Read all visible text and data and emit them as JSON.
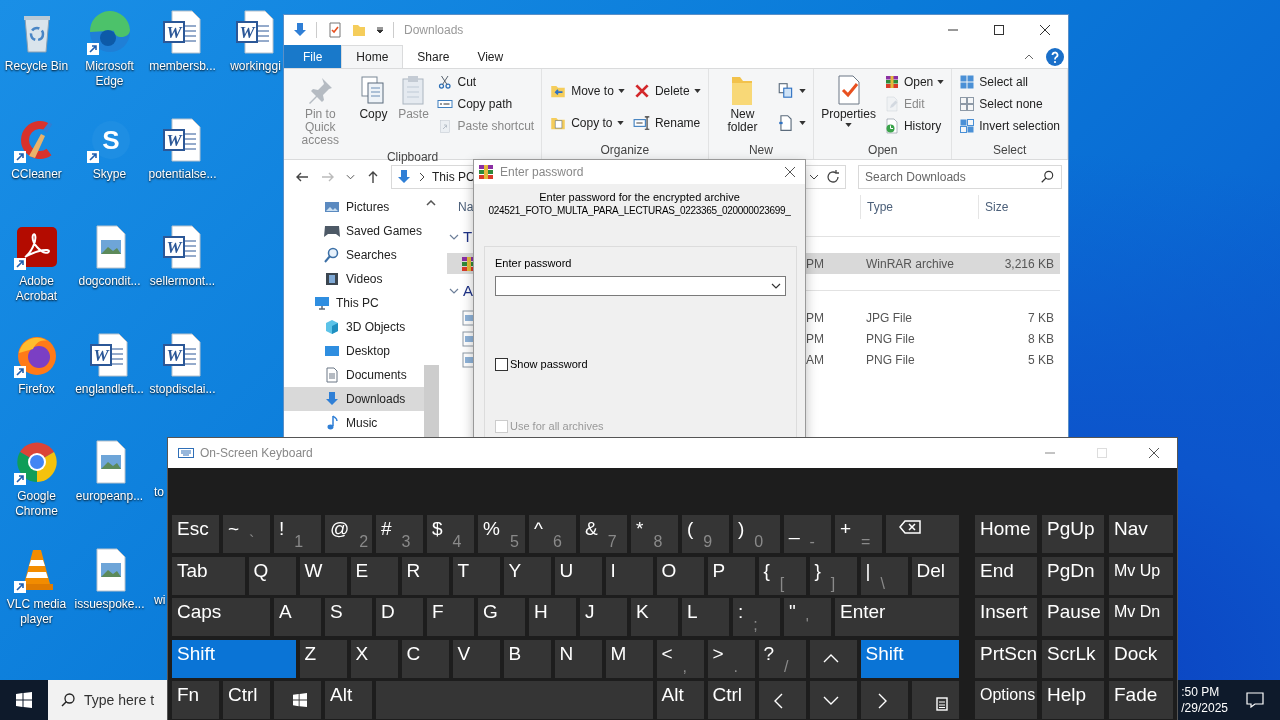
{
  "desktop_icons": [
    {
      "label": "Recycle Bin",
      "kind": "recycle",
      "shortcut": false
    },
    {
      "label": "CCleaner",
      "kind": "ccleaner",
      "shortcut": true
    },
    {
      "label": "Adobe Acrobat",
      "kind": "pdf",
      "shortcut": true
    },
    {
      "label": "Firefox",
      "kind": "firefox",
      "shortcut": true
    },
    {
      "label": "Google Chrome",
      "kind": "chrome",
      "shortcut": true
    },
    {
      "label": "VLC media player",
      "kind": "vlc",
      "shortcut": true
    },
    {
      "label": "Microsoft Edge",
      "kind": "edge",
      "shortcut": true
    },
    {
      "label": "Skype",
      "kind": "skype",
      "glyph": "S",
      "shortcut": true
    },
    {
      "label": "dogcondit...",
      "kind": "image",
      "shortcut": false
    },
    {
      "label": "englandleft...",
      "kind": "word",
      "glyph": "W",
      "shortcut": false
    },
    {
      "label": "europeanp...",
      "kind": "image",
      "shortcut": false
    },
    {
      "label": "issuespoke...",
      "kind": "image",
      "shortcut": false
    },
    {
      "label": "membersb...",
      "kind": "word",
      "glyph": "W",
      "shortcut": false
    },
    {
      "label": "potentialse...",
      "kind": "word",
      "glyph": "W",
      "shortcut": false
    },
    {
      "label": "sellermont...",
      "kind": "word",
      "glyph": "W",
      "shortcut": false
    },
    {
      "label": "stopdisclai...",
      "kind": "word",
      "glyph": "W",
      "shortcut": false
    },
    {
      "label": "to",
      "kind": "covered"
    },
    {
      "label": "wi",
      "kind": "covered"
    },
    {
      "label": "workinggi",
      "kind": "word",
      "glyph": "W",
      "shortcut": false
    }
  ],
  "explorer": {
    "title": "Downloads",
    "tabs": [
      {
        "label": "File",
        "kind": "file",
        "selected": false
      },
      {
        "label": "Home",
        "kind": "tab",
        "selected": true
      },
      {
        "label": "Share",
        "kind": "tab",
        "selected": false
      },
      {
        "label": "View",
        "kind": "tab",
        "selected": false
      }
    ],
    "ribbon": [
      {
        "label": "Clipboard",
        "columns": [
          [
            {
              "label": "Pin to Quick access",
              "disabled": true,
              "dropdown": false
            }
          ],
          [
            {
              "label": "Copy",
              "disabled": false,
              "dropdown": false
            }
          ],
          [
            {
              "label": "Paste",
              "disabled": true,
              "dropdown": false
            }
          ],
          [
            {
              "label": "Cut",
              "disabled": false,
              "dropdown": false
            },
            {
              "label": "Copy path",
              "disabled": false,
              "dropdown": false
            },
            {
              "label": "Paste shortcut",
              "disabled": true,
              "dropdown": false
            }
          ]
        ]
      },
      {
        "label": "Organize",
        "columns": [
          [
            {
              "label": "Move to",
              "disabled": false,
              "dropdown": true
            },
            {
              "label": "Copy to",
              "disabled": false,
              "dropdown": true
            }
          ],
          [
            {
              "label": "Delete",
              "disabled": false,
              "dropdown": true
            },
            {
              "label": "Rename",
              "disabled": false,
              "dropdown": false
            }
          ]
        ]
      },
      {
        "label": "New",
        "columns": [
          [
            {
              "label": "New folder",
              "disabled": false,
              "dropdown": false
            }
          ],
          [
            {
              "disabled": false,
              "dropdown": true
            },
            {
              "disabled": false,
              "dropdown": true
            }
          ]
        ]
      },
      {
        "label": "Open",
        "columns": [
          [
            {
              "label": "Properties",
              "disabled": false,
              "dropdown": true
            }
          ],
          [
            {
              "label": "Open",
              "disabled": false,
              "dropdown": true
            },
            {
              "label": "Edit",
              "disabled": true,
              "dropdown": false
            },
            {
              "label": "History",
              "disabled": false,
              "dropdown": false
            }
          ]
        ]
      },
      {
        "label": "Select",
        "columns": [
          [
            {
              "label": "Select all",
              "disabled": false,
              "dropdown": false
            },
            {
              "label": "Select none",
              "disabled": false,
              "dropdown": false
            },
            {
              "label": "Invert selection",
              "disabled": false,
              "dropdown": false
            }
          ]
        ]
      }
    ],
    "back": {
      "disabled": false
    },
    "forward": {
      "disabled": true
    },
    "address": "This PC",
    "search": {
      "placeholder": "Search Downloads"
    },
    "nav": {
      "continued_children": [
        {
          "label": "Pictures",
          "selected": false
        },
        {
          "label": "Saved Games",
          "selected": false
        },
        {
          "label": "Searches",
          "selected": false
        },
        {
          "label": "Videos",
          "selected": false
        }
      ],
      "items": [
        {
          "label": "This PC",
          "selected": false,
          "children": [
            {
              "label": "3D Objects",
              "selected": false
            },
            {
              "label": "Desktop",
              "selected": false
            },
            {
              "label": "Documents",
              "selected": false
            },
            {
              "label": "Downloads",
              "selected": true
            },
            {
              "label": "Music",
              "selected": false
            }
          ]
        }
      ]
    },
    "columns": [
      "Na",
      "Type",
      "Size"
    ],
    "groups": [
      {
        "label": "T",
        "expanded": true,
        "rows": [
          {
            "kind": "archive",
            "date": "PM",
            "type": "WinRAR archive",
            "size": "3,216 KB",
            "selected": true
          }
        ]
      },
      {
        "label": "A",
        "expanded": true,
        "rows": [
          {
            "kind": "image",
            "date": "PM",
            "type": "JPG File",
            "size": "7 KB",
            "selected": false
          },
          {
            "kind": "image",
            "date": "PM",
            "type": "PNG File",
            "size": "8 KB",
            "selected": false
          },
          {
            "kind": "image",
            "date": "AM",
            "type": "PNG File",
            "size": "5 KB",
            "selected": false
          }
        ]
      }
    ]
  },
  "dialog": {
    "title": "Enter password",
    "message": "Enter password for the encrypted archive",
    "archive": "024521_FOTO_MULTA_PARA_LECTURAS_0223365_020000023699_",
    "field_label": "Enter password",
    "options": [
      {
        "label": "Show password",
        "checked": false,
        "disabled": false
      },
      {
        "label": "Use for all archives",
        "checked": false,
        "disabled": true
      }
    ]
  },
  "keyboard": {
    "title": "On-Screen Keyboard",
    "maximize": {
      "disabled": true
    },
    "rows": [
      {
        "keys": [
          {
            "label": "Esc",
            "kind": "char",
            "on": false
          },
          {
            "label": "~",
            "sub": "`",
            "kind": "char",
            "on": false
          },
          {
            "label": "!",
            "sub": "1",
            "kind": "char",
            "on": false
          },
          {
            "label": "@",
            "sub": "2",
            "kind": "char",
            "on": false
          },
          {
            "label": "#",
            "sub": "3",
            "kind": "char",
            "on": false
          },
          {
            "label": "$",
            "sub": "4",
            "kind": "char",
            "on": false
          },
          {
            "label": "%",
            "sub": "5",
            "kind": "char",
            "on": false
          },
          {
            "label": "^",
            "sub": "6",
            "kind": "char",
            "on": false
          },
          {
            "label": "&",
            "sub": "7",
            "kind": "char",
            "on": false
          },
          {
            "label": "*",
            "sub": "8",
            "kind": "char",
            "on": false
          },
          {
            "label": "(",
            "sub": "9",
            "kind": "char",
            "on": false
          },
          {
            "label": ")",
            "sub": "0",
            "kind": "char",
            "on": false
          },
          {
            "label": "_",
            "sub": "-",
            "kind": "char",
            "on": false
          },
          {
            "label": "+",
            "sub": "=",
            "kind": "char",
            "on": false
          },
          {
            "kind": "backspace",
            "on": false
          }
        ]
      },
      {
        "keys": [
          {
            "label": "Tab",
            "kind": "tab",
            "on": false
          },
          {
            "label": "Q",
            "kind": "char",
            "on": false
          },
          {
            "label": "W",
            "kind": "char",
            "on": false
          },
          {
            "label": "E",
            "kind": "char",
            "on": false
          },
          {
            "label": "R",
            "kind": "char",
            "on": false
          },
          {
            "label": "T",
            "kind": "char",
            "on": false
          },
          {
            "label": "Y",
            "kind": "char",
            "on": false
          },
          {
            "label": "U",
            "kind": "char",
            "on": false
          },
          {
            "label": "I",
            "kind": "char",
            "on": false
          },
          {
            "label": "O",
            "kind": "char",
            "on": false
          },
          {
            "label": "P",
            "kind": "char",
            "on": false
          },
          {
            "label": "{",
            "sub": "[",
            "kind": "char",
            "on": false
          },
          {
            "label": "}",
            "sub": "]",
            "kind": "char",
            "on": false
          },
          {
            "label": "|",
            "sub": "\\",
            "kind": "char",
            "on": false
          },
          {
            "label": "Del",
            "kind": "char",
            "on": false
          }
        ]
      },
      {
        "keys": [
          {
            "label": "Caps",
            "kind": "caps",
            "on": false
          },
          {
            "label": "A",
            "kind": "char",
            "on": false
          },
          {
            "label": "S",
            "kind": "char",
            "on": false
          },
          {
            "label": "D",
            "kind": "char",
            "on": false
          },
          {
            "label": "F",
            "kind": "char",
            "on": false
          },
          {
            "label": "G",
            "kind": "char",
            "on": false
          },
          {
            "label": "H",
            "kind": "char",
            "on": false
          },
          {
            "label": "J",
            "kind": "char",
            "on": false
          },
          {
            "label": "K",
            "kind": "char",
            "on": false
          },
          {
            "label": "L",
            "kind": "char",
            "on": false
          },
          {
            "label": ":",
            "sub": ";",
            "kind": "char",
            "on": false
          },
          {
            "label": "\"",
            "sub": "'",
            "kind": "char",
            "on": false
          },
          {
            "label": "Enter",
            "kind": "enter",
            "on": false
          }
        ]
      },
      {
        "keys": [
          {
            "label": "Shift",
            "kind": "lshift",
            "on": true
          },
          {
            "label": "Z",
            "kind": "char",
            "on": false
          },
          {
            "label": "X",
            "kind": "char",
            "on": false
          },
          {
            "label": "C",
            "kind": "char",
            "on": false
          },
          {
            "label": "V",
            "kind": "char",
            "on": false
          },
          {
            "label": "B",
            "kind": "char",
            "on": false
          },
          {
            "label": "N",
            "kind": "char",
            "on": false
          },
          {
            "label": "M",
            "kind": "char",
            "on": false
          },
          {
            "label": "<",
            "sub": ",",
            "kind": "char",
            "on": false
          },
          {
            "label": ">",
            "sub": ".",
            "kind": "char",
            "on": false
          },
          {
            "label": "?",
            "sub": "/",
            "kind": "char",
            "on": false
          },
          {
            "kind": "up",
            "on": false
          },
          {
            "label": "Shift",
            "kind": "rshift",
            "on": true
          }
        ]
      },
      {
        "keys": [
          {
            "label": "Fn",
            "kind": "char",
            "on": false
          },
          {
            "label": "Ctrl",
            "kind": "char",
            "on": false
          },
          {
            "kind": "windows",
            "on": false
          },
          {
            "label": "Alt",
            "kind": "char",
            "on": false
          },
          {
            "kind": "space",
            "on": false
          },
          {
            "label": "Alt",
            "kind": "char",
            "on": false
          },
          {
            "label": "Ctrl",
            "kind": "char",
            "on": false
          },
          {
            "kind": "left",
            "on": false
          },
          {
            "kind": "down",
            "on": false
          },
          {
            "kind": "right",
            "on": false
          },
          {
            "kind": "menu",
            "on": false
          }
        ]
      }
    ],
    "side_keys": [
      {
        "label": "Home",
        "kind": "char",
        "on": false
      },
      {
        "label": "PgUp",
        "kind": "char",
        "on": false
      },
      {
        "label": "Nav",
        "kind": "char",
        "on": false
      },
      {
        "label": "End",
        "kind": "char",
        "on": false
      },
      {
        "label": "PgDn",
        "kind": "char",
        "on": false
      },
      {
        "label": "Mv Up",
        "kind": "small",
        "on": false
      },
      {
        "label": "Insert",
        "kind": "char",
        "on": false
      },
      {
        "label": "Pause",
        "kind": "char",
        "on": false
      },
      {
        "label": "Mv Dn",
        "kind": "small",
        "on": false
      },
      {
        "label": "PrtScn",
        "kind": "char",
        "on": false
      },
      {
        "label": "ScrLk",
        "kind": "char",
        "on": false
      },
      {
        "label": "Dock",
        "kind": "char",
        "on": false
      },
      {
        "label": "Options",
        "kind": "small",
        "on": false
      },
      {
        "label": "Help",
        "kind": "char",
        "on": false
      },
      {
        "label": "Fade",
        "kind": "char",
        "on": false
      }
    ]
  },
  "taskbar": {
    "search": {
      "placeholder": "Type here t"
    },
    "time": ":50 PM",
    "date": "/29/2025"
  }
}
